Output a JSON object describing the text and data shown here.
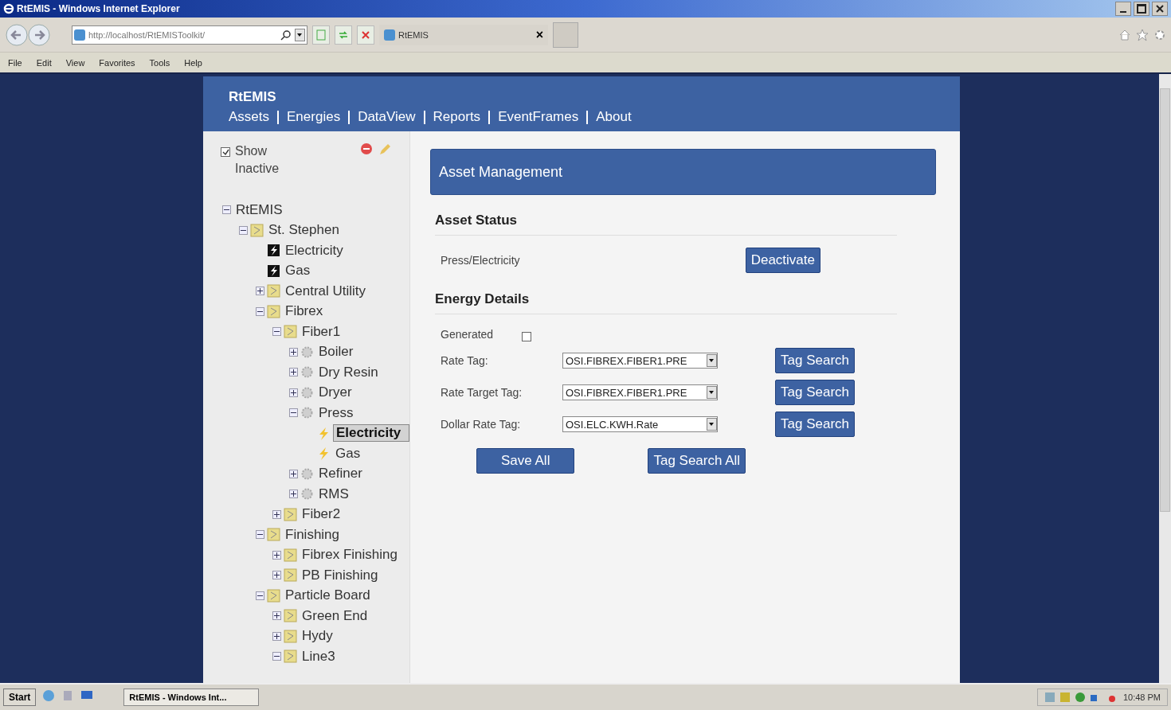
{
  "window": {
    "title": "RtEMIS - Windows Internet Explorer"
  },
  "browser": {
    "address": "http://localhost/RtEMISToolkit/",
    "tab": {
      "label": "RtEMIS",
      "close": "×"
    },
    "menu": [
      "File",
      "Edit",
      "View",
      "Favorites",
      "Tools",
      "Help"
    ]
  },
  "app": {
    "brand": "RtEMIS",
    "nav": [
      {
        "label": "Assets"
      },
      {
        "label": "Energies"
      },
      {
        "label": "DataView"
      },
      {
        "label": "Reports"
      },
      {
        "label": "EventFrames"
      },
      {
        "label": "About"
      }
    ]
  },
  "sidebar": {
    "show_inactive": {
      "label": "Show Inactive",
      "checked": true
    },
    "tree": [
      {
        "label": "RtEMIS",
        "expanded": true,
        "selected": false,
        "children": [
          {
            "label": "St. Stephen",
            "kind": "site",
            "expanded": true,
            "selected": false,
            "children": [
              {
                "label": "Electricity",
                "kind": "energy",
                "selected": false
              },
              {
                "label": "Gas",
                "kind": "energy",
                "selected": false
              },
              {
                "label": "Central Utility",
                "kind": "site",
                "expanded": false,
                "selected": false
              },
              {
                "label": "Fibrex",
                "kind": "site",
                "expanded": true,
                "selected": false,
                "children": [
                  {
                    "label": "Fiber1",
                    "kind": "site",
                    "expanded": true,
                    "selected": false,
                    "children": [
                      {
                        "label": "Boiler",
                        "kind": "equipment",
                        "expanded": false,
                        "selected": false
                      },
                      {
                        "label": "Dry Resin",
                        "kind": "equipment",
                        "expanded": false,
                        "selected": false
                      },
                      {
                        "label": "Dryer",
                        "kind": "equipment",
                        "expanded": false,
                        "selected": false
                      },
                      {
                        "label": "Press",
                        "kind": "equipment",
                        "expanded": true,
                        "selected": false,
                        "children": [
                          {
                            "label": "Electricity",
                            "kind": "feed",
                            "selected": true
                          },
                          {
                            "label": "Gas",
                            "kind": "feed",
                            "selected": false
                          }
                        ]
                      },
                      {
                        "label": "Refiner",
                        "kind": "equipment",
                        "expanded": false,
                        "selected": false
                      },
                      {
                        "label": "RMS",
                        "kind": "equipment",
                        "expanded": false,
                        "selected": false
                      }
                    ]
                  },
                  {
                    "label": "Fiber2",
                    "kind": "site",
                    "expanded": false,
                    "selected": false
                  }
                ]
              },
              {
                "label": "Finishing",
                "kind": "site",
                "expanded": true,
                "selected": false,
                "children": [
                  {
                    "label": "Fibrex Finishing",
                    "kind": "site",
                    "expanded": false,
                    "selected": false
                  },
                  {
                    "label": "PB Finishing",
                    "kind": "site",
                    "expanded": false,
                    "selected": false
                  }
                ]
              },
              {
                "label": "Particle Board",
                "kind": "site",
                "expanded": true,
                "selected": false,
                "children": [
                  {
                    "label": "Green End",
                    "kind": "site",
                    "expanded": false,
                    "selected": false
                  },
                  {
                    "label": "Hydy",
                    "kind": "site",
                    "expanded": false,
                    "selected": false
                  },
                  {
                    "label": "Line3",
                    "kind": "site",
                    "expanded": true,
                    "selected": false
                  }
                ]
              }
            ]
          }
        ]
      }
    ]
  },
  "main": {
    "title": "Asset Management",
    "asset_status": {
      "heading": "Asset Status",
      "asset": "Press/Electricity",
      "button": "Deactivate"
    },
    "energy_details": {
      "heading": "Energy Details",
      "generated": {
        "label": "Generated",
        "checked": false
      },
      "fields": [
        {
          "label": "Rate Tag:",
          "value": "OSI.FIBREX.FIBER1.PRE",
          "button": "Tag Search"
        },
        {
          "label": "Rate Target Tag:",
          "value": "OSI.FIBREX.FIBER1.PRE",
          "button": "Tag Search"
        },
        {
          "label": "Dollar Rate Tag:",
          "value": "OSI.ELC.KWH.Rate",
          "button": "Tag Search"
        }
      ],
      "actions": [
        "Save All",
        "Tag Search All"
      ]
    }
  },
  "taskbar": {
    "start": "Start",
    "task": "RtEMIS - Windows Int...",
    "clock": "10:48 PM"
  }
}
